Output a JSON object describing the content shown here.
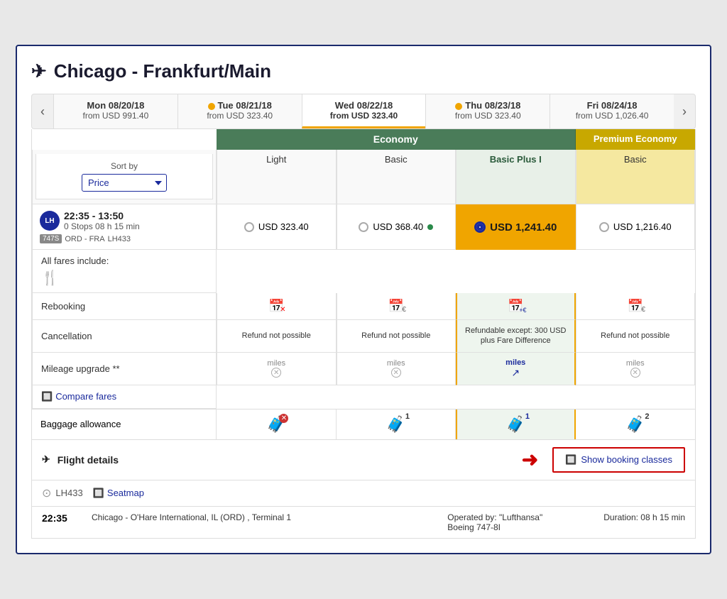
{
  "title": "Chicago - Frankfurt/Main",
  "dates": [
    {
      "label": "Mon 08/20/18",
      "price": "from USD 991.40",
      "active": false,
      "dot": false
    },
    {
      "label": "Tue 08/21/18",
      "price": "from USD 323.40",
      "active": false,
      "dot": true
    },
    {
      "label": "Wed 08/22/18",
      "price": "from USD 323.40",
      "active": true,
      "dot": false
    },
    {
      "label": "Thu 08/23/18",
      "price": "from USD 323.40",
      "active": false,
      "dot": true
    },
    {
      "label": "Fri 08/24/18",
      "price": "from USD 1,026.40",
      "active": false,
      "dot": false
    }
  ],
  "sort": {
    "label": "Sort by",
    "value": "Price"
  },
  "columns": {
    "economy_label": "Economy",
    "premium_label": "Premium Economy",
    "light": "Light",
    "basic": "Basic",
    "basic_plus": "Basic Plus I",
    "prem_basic": "Basic"
  },
  "flight": {
    "time": "22:35 - 13:50",
    "stops": "0 Stops 08 h 15 min",
    "route": "ORD - FRA",
    "flight_number": "LH433"
  },
  "prices": {
    "light": "USD 323.40",
    "basic": "USD 368.40",
    "basic_plus": "USD 1,241.40",
    "prem_basic": "USD 1,216.40"
  },
  "fares": {
    "rebooking": "Rebooking",
    "cancellation": "Cancellation",
    "mileage": "Mileage upgrade **",
    "baggage": "Baggage allowance"
  },
  "cancellation_text": {
    "refund_not_possible": "Refund not possible",
    "basic_plus_text": "Refundable except: 300 USD plus Fare Difference"
  },
  "miles_label": "miles",
  "all_fares_label": "All fares include:",
  "compare_fares_label": "Compare fares",
  "flight_details_label": "Flight details",
  "show_booking_label": "Show booking classes",
  "lh_number": "LH433",
  "seatmap_label": "Seatmap",
  "departure_time": "22:35",
  "departure_info": "Chicago - O'Hare International, IL (ORD) , Terminal 1",
  "operated_by": "Operated by: \"Lufthansa\"",
  "aircraft": "Boeing 747-8I",
  "duration": "Duration: 08 h 15 min"
}
